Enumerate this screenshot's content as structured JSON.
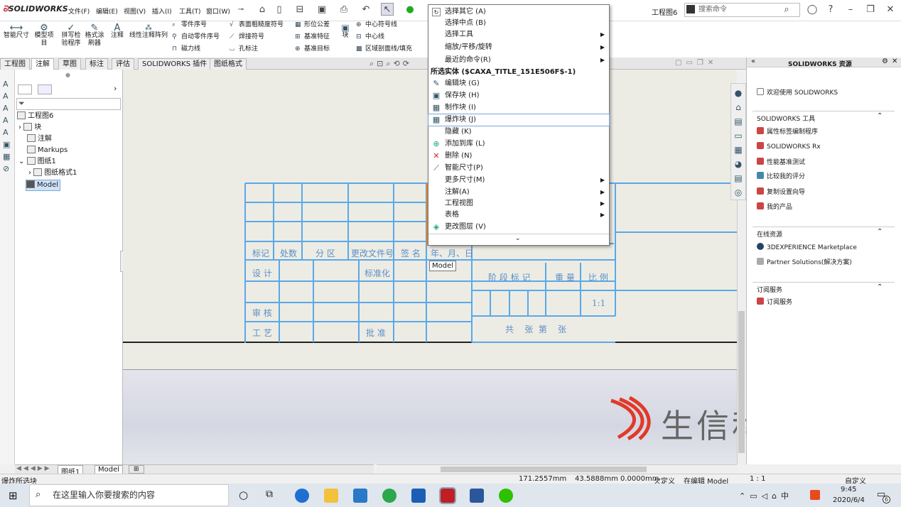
{
  "app": {
    "brand": "SOLIDWORKS",
    "doc_title": "工程图6",
    "search_placeholder": "搜索命令",
    "menus": [
      "文件(F)",
      "编辑(E)",
      "视图(V)",
      "插入(I)",
      "工具(T)",
      "窗口(W)"
    ]
  },
  "ribbon": {
    "smart_dim": "智能尺寸",
    "model_items": [
      "模型项",
      "目"
    ],
    "spellcheck": [
      "拼写检",
      "验程序"
    ],
    "format_painter": [
      "格式涂",
      "刷器"
    ],
    "note": "注释",
    "linear_note_pattern": "线性注释阵列",
    "col1": [
      "零件序号",
      "自动零件序号",
      "磁力线"
    ],
    "col2": [
      "表面粗糙度符号",
      "焊接符号",
      "孔标注"
    ],
    "col3": [
      "形位公差",
      "基准特征",
      "基准目标"
    ],
    "block": "块",
    "col4": [
      "中心符号线",
      "中心线",
      "区域剖面线/填充"
    ]
  },
  "tabs": [
    "工程图",
    "注解",
    "草图",
    "标注",
    "评估",
    "SOLIDWORKS 插件",
    "图纸格式"
  ],
  "active_tab": "注解",
  "tree": {
    "root": "工程图6",
    "items": [
      "块",
      "注解",
      "Markups",
      "图纸1",
      "图纸格式1",
      "Model"
    ]
  },
  "context_menu": {
    "items": [
      {
        "label": "选择其它 (A)",
        "icon": "select-other-icon",
        "arrow": false
      },
      {
        "label": "选择中点 (B)",
        "icon": "",
        "arrow": false
      },
      {
        "label": "选择工具",
        "icon": "",
        "arrow": true
      },
      {
        "label": "缩放/平移/旋转",
        "icon": "",
        "arrow": true
      },
      {
        "label": "最近的命令(R)",
        "icon": "",
        "arrow": true
      }
    ],
    "section_header": "所选实体 ($CAXA_TITLE_151E506F$-1)",
    "items2": [
      {
        "label": "编辑块 (G)",
        "icon": "edit-block-icon",
        "arrow": false
      },
      {
        "label": "保存块 (H)",
        "icon": "save-block-icon",
        "arrow": false
      },
      {
        "label": "制作块 (I)",
        "icon": "make-block-icon",
        "arrow": false
      },
      {
        "label": "爆炸块 (J)",
        "icon": "explode-block-icon",
        "arrow": false,
        "highlighted": true
      },
      {
        "label": "隐藏 (K)",
        "icon": "",
        "arrow": false
      },
      {
        "label": "添加到库 (L)",
        "icon": "add-to-library-icon",
        "arrow": false
      },
      {
        "label": "删除 (N)",
        "icon": "delete-icon",
        "arrow": false
      },
      {
        "label": "智能尺寸(P)",
        "icon": "smart-dimension-icon",
        "arrow": false
      },
      {
        "label": "更多尺寸(M)",
        "icon": "",
        "arrow": true
      },
      {
        "label": "注解(A)",
        "icon": "",
        "arrow": true
      },
      {
        "label": "工程视图",
        "icon": "",
        "arrow": true
      },
      {
        "label": "表格",
        "icon": "",
        "arrow": true
      },
      {
        "label": "更改图层 (V)",
        "icon": "change-layer-icon",
        "arrow": false
      }
    ],
    "expand": "⌄"
  },
  "tooltip": "Model",
  "title_block": {
    "row_labels": [
      "标记",
      "处数",
      "分 区",
      "更改文件号",
      "签 名",
      "年、月、日"
    ],
    "design": "设 计",
    "standardization": "标准化",
    "review": "审 核",
    "process": "工 艺",
    "approve": "批 准",
    "stage_mark": "阶 段 标 记",
    "weight": "重 量",
    "scale": "比 例",
    "scale_value": "1:1",
    "sheets": "共    张  第    张"
  },
  "watermark": "生信科技",
  "taskpane": {
    "title": "SOLIDWORKS 资源",
    "welcome": "欢迎使用 SOLIDWORKS",
    "tools_header": "SOLIDWORKS 工具",
    "tools": [
      "属性标签编制程序",
      "SOLIDWORKS Rx",
      "性能基准测试",
      "比较我的评分",
      "复制设置向导",
      "我的产品"
    ],
    "online_header": "在线资源",
    "online": [
      "3DEXPERIENCE Marketplace",
      "Partner Solutions(解决方案)"
    ],
    "subscription_header": "订阅服务",
    "subscription": [
      "订阅服务"
    ]
  },
  "sheet_tabs": [
    "图纸1",
    "Model"
  ],
  "status": {
    "left": "爆炸所选块",
    "x": "171.2557mm",
    "y": "43.5888mm 0.0000mm",
    "defined": "欠定义",
    "editing": "在编辑 Model",
    "scale": "1 : 1",
    "custom": "自定义"
  },
  "taskbar": {
    "search_placeholder": "在这里输入你要搜索的内容",
    "time": "9:45",
    "date": "2020/6/4",
    "notify_count": "6"
  }
}
